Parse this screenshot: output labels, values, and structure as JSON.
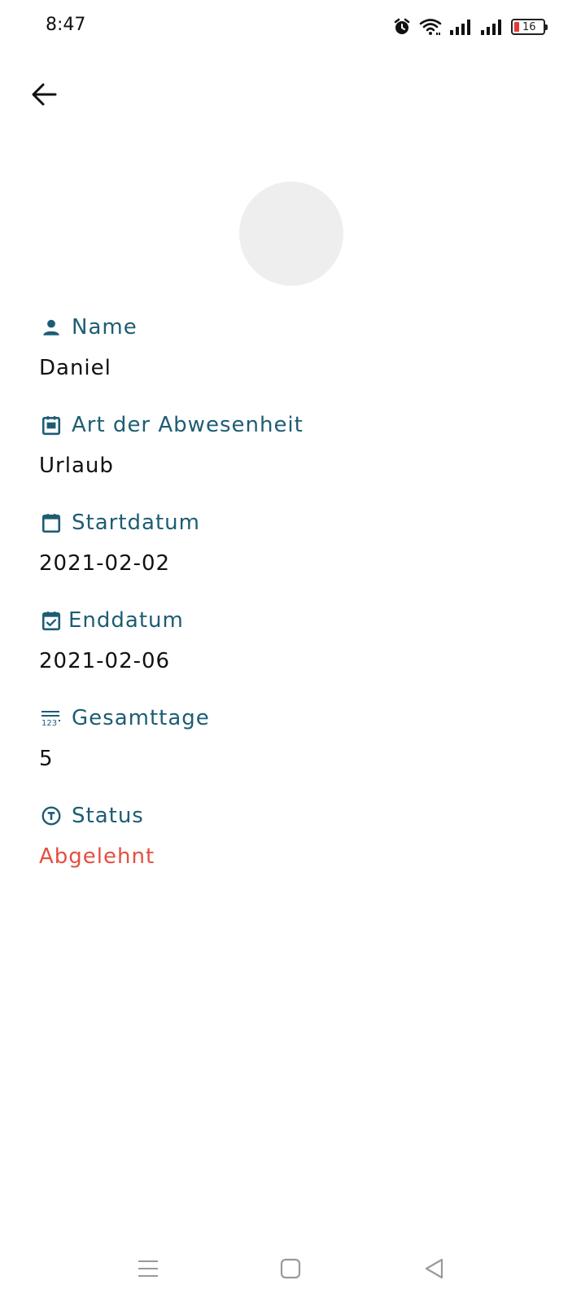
{
  "status_bar": {
    "time": "8:47",
    "battery_level": "16",
    "icons": [
      "alarm-icon",
      "wifi-icon",
      "signal-icon",
      "signal-icon",
      "battery-icon"
    ]
  },
  "header": {
    "back_icon": "arrow-left-icon"
  },
  "fields": {
    "name": {
      "label": "Name",
      "value": "Daniel",
      "icon": "person-icon"
    },
    "absence_type": {
      "label": "Art der Abwesenheit",
      "value": "Urlaub",
      "icon": "calendar-icon"
    },
    "start_date": {
      "label": "Startdatum",
      "value": "2021-02-02",
      "icon": "calendar-blank-icon"
    },
    "end_date": {
      "label": "Enddatum",
      "value": "2021-02-06",
      "icon": "calendar-check-icon"
    },
    "total_days": {
      "label": "Gesamttage",
      "value": "5",
      "icon": "numbers-icon"
    },
    "status": {
      "label": "Status",
      "value": "Abgelehnt",
      "icon": "status-icon"
    }
  },
  "colors": {
    "label": "#1d5d74",
    "value": "#111111",
    "rejected": "#e34f42",
    "avatar_bg": "#eeeeee"
  },
  "nav_bar": {
    "icons": [
      "menu-icon",
      "home-icon",
      "back-triangle-icon"
    ]
  }
}
